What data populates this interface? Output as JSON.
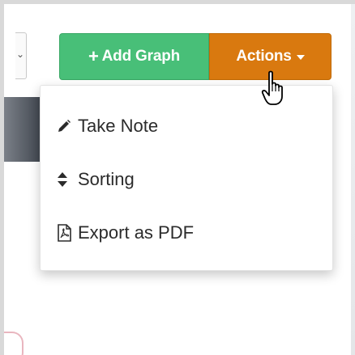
{
  "toolbar": {
    "add_graph_label": "Add Graph",
    "actions_label": "Actions"
  },
  "actions_menu": {
    "items": [
      {
        "label": "Take Note",
        "icon": "pencil-icon"
      },
      {
        "label": "Sorting",
        "icon": "sort-icon"
      },
      {
        "label": "Export as PDF",
        "icon": "pdf-file-icon"
      }
    ]
  },
  "colors": {
    "add_graph_bg": "#48bf78",
    "actions_bg": "#d9790f",
    "menu_text": "#2b2b2b"
  }
}
